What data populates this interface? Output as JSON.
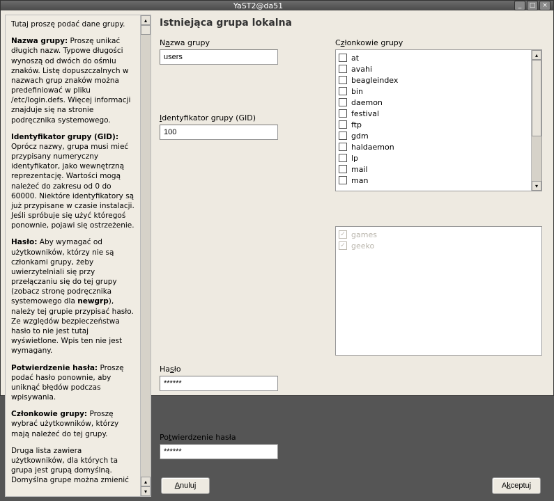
{
  "window": {
    "title": "YaST2@da51"
  },
  "help": {
    "intro": "Tutaj proszę podać dane grupy.",
    "p1_label": "Nazwa grupy:",
    "p1": " Proszę unikać długich nazw. Typowe długości wynoszą od dwóch do ośmiu znaków. Listę dopuszczalnych w nazwach grup znaków można predefiniować w pliku /etc/login.defs. Więcej informacji znajduje się na stronie podręcznika systemowego.",
    "p2_label": "Identyfikator grupy (GID):",
    "p2": " Oprócz nazwy, grupa musi mieć przypisany numeryczny identyfikator, jako wewnętrzną reprezentację. Wartości mogą należeć do zakresu od 0 do 60000. Niektóre identyfikatory są już przypisane w czasie instalacji. Jeśli spróbuje się użyć któregoś ponownie, pojawi się ostrzeżenie.",
    "p3_label": "Hasło:",
    "p3a": " Aby wymagać od użytkowników, którzy nie są członkami grupy, żeby uwierzytelniali się przy przełączaniu się do tej grupy (zobacz stronę podręcznika systemowego dla ",
    "p3code": "newgrp",
    "p3b": "), należy tej grupie przypisać hasło. Ze względów bezpieczeństwa hasło to nie jest tutaj wyświetlone. Wpis ten nie jest wymagany.",
    "p4_label": "Potwierdzenie hasła:",
    "p4": " Proszę podać hasło ponownie, aby uniknąć błędów podczas wpisywania.",
    "p5_label": "Członkowie grupy:",
    "p5": " Proszę wybrać użytkowników, którzy mają należeć do tej grupy.",
    "p6": "Druga lista zawiera użytkowników, dla których ta grupa jest grupą domyślną. Domyślna grupe można zmienić"
  },
  "page": {
    "title": "Istniejąca grupa lokalna",
    "group_name_label_pre": "N",
    "group_name_label_u": "a",
    "group_name_label_post": "zwa grupy",
    "group_name_value": "users",
    "gid_label_u": "I",
    "gid_label_post": "dentyfikator grupy (GID)",
    "gid_value": "100",
    "password_label_pre": "Ha",
    "password_label_u": "s",
    "password_label_post": "ło",
    "password_value": "******",
    "confirm_label_pre": "Po",
    "confirm_label_u": "t",
    "confirm_label_post": "wierdzenie hasła",
    "confirm_value": "******",
    "members_label_pre": "C",
    "members_label_u": "z",
    "members_label_post": "łonkowie grupy",
    "members": [
      "at",
      "avahi",
      "beagleindex",
      "bin",
      "daemon",
      "festival",
      "ftp",
      "gdm",
      "haldaemon",
      "lp",
      "mail",
      "man"
    ],
    "default_members": [
      "games",
      "geeko"
    ]
  },
  "buttons": {
    "cancel_u": "A",
    "cancel_post": "nuluj",
    "accept_pre": "A",
    "accept_u": "k",
    "accept_post": "ceptuj"
  }
}
